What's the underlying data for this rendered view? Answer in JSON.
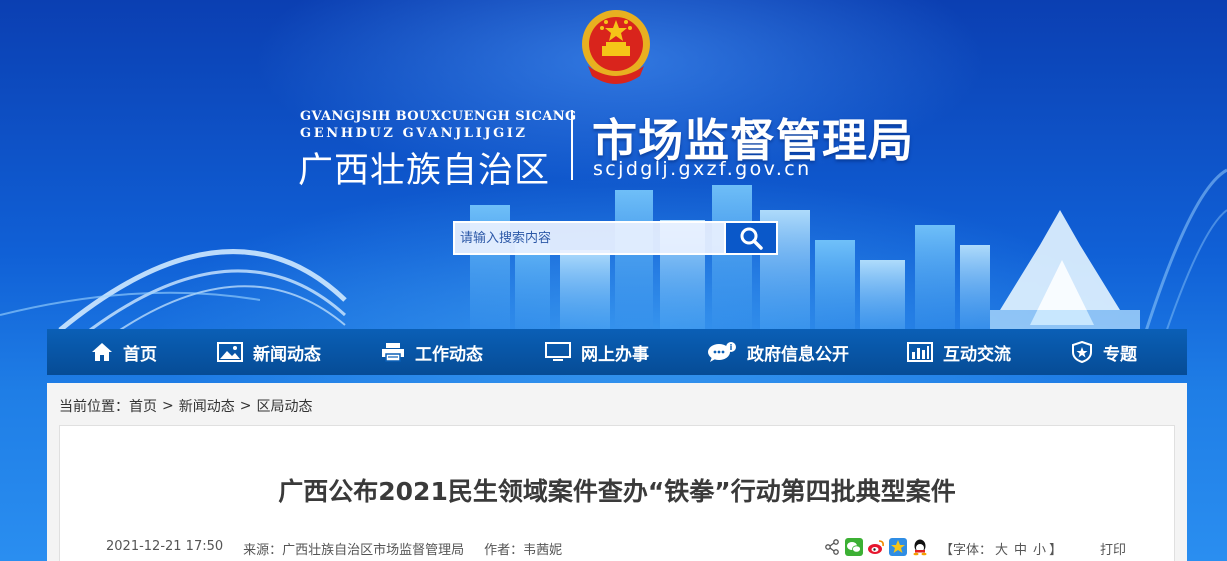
{
  "header": {
    "pinyin_line1": "GVANGJSIH BOUXCUENGH SICANG",
    "pinyin_line2": "GENHDUZ GVANJLIJGIZ",
    "region_name": "广西壮族自治区",
    "bureau_name": "市场监督管理局",
    "domain": "scjdglj.gxzf.gov.cn",
    "emblem_icon": "national-emblem-icon"
  },
  "search": {
    "placeholder": "请输入搜索内容",
    "value": "",
    "button_icon": "search-icon"
  },
  "nav": {
    "items": [
      {
        "label": "首页",
        "icon": "home-icon"
      },
      {
        "label": "新闻动态",
        "icon": "image-icon"
      },
      {
        "label": "工作动态",
        "icon": "printer-icon"
      },
      {
        "label": "网上办事",
        "icon": "monitor-icon"
      },
      {
        "label": "政府信息公开",
        "icon": "speech-bubble-icon"
      },
      {
        "label": "互动交流",
        "icon": "bar-chart-icon"
      },
      {
        "label": "专题",
        "icon": "shield-icon"
      }
    ]
  },
  "breadcrumb": {
    "prefix": "当前位置：",
    "items": [
      "首页",
      "新闻动态",
      "区局动态"
    ],
    "separator": ">"
  },
  "article": {
    "title": "广西公布2021民生领域案件查办“铁拳”行动第四批典型案件",
    "datetime": "2021-12-21 17:50",
    "source": "来源：广西壮族自治区市场监督管理局",
    "author": "作者：韦茜妮",
    "share_icons": [
      "share-icon",
      "wechat-icon",
      "weibo-icon",
      "qzone-icon",
      "qq-icon"
    ],
    "fontsize_label_open": "【字体：",
    "fontsize_options": [
      "大",
      "中",
      "小"
    ],
    "fontsize_label_close": "】",
    "print_label": "打印"
  },
  "colors": {
    "nav_bg": "#0a5fb6",
    "banner_top": "#0b3fb2",
    "title_text": "#3a3a3a"
  }
}
